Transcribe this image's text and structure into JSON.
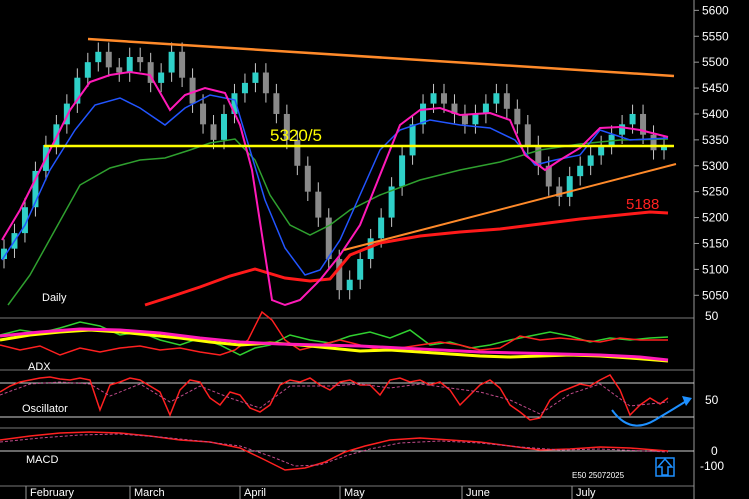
{
  "chart_data": [
    {
      "type": "candlestick",
      "panel_label": "Daily",
      "x_months": [
        "February",
        "March",
        "April",
        "May",
        "June",
        "July"
      ],
      "y_ticks": [
        5050,
        5100,
        5150,
        5200,
        5250,
        5300,
        5350,
        5400,
        5450,
        5500,
        5550,
        5600
      ],
      "ylim": [
        5010,
        5620
      ],
      "annotations": [
        {
          "label": "5320/5",
          "value": 5322,
          "color": "#ffff00"
        },
        {
          "label": "5188",
          "value": 5188,
          "color": "#ff2020"
        }
      ],
      "approx_closes": [
        5140,
        5170,
        5220,
        5290,
        5340,
        5380,
        5420,
        5470,
        5500,
        5520,
        5490,
        5480,
        5510,
        5500,
        5460,
        5480,
        5520,
        5470,
        5420,
        5380,
        5350,
        5400,
        5440,
        5460,
        5480,
        5440,
        5400,
        5350,
        5300,
        5250,
        5200,
        5120,
        5060,
        5080,
        5120,
        5160,
        5200,
        5260,
        5320,
        5380,
        5420,
        5440,
        5420,
        5400,
        5380,
        5400,
        5420,
        5440,
        5410,
        5380,
        5340,
        5300,
        5260,
        5240,
        5280,
        5300,
        5320,
        5340,
        5360,
        5380,
        5400,
        5360,
        5330,
        5340
      ]
    },
    {
      "type": "line",
      "panel_label": "ADX",
      "y_ticks": [
        50
      ]
    },
    {
      "type": "line",
      "panel_label": "Oscillator",
      "y_ticks": [
        50
      ]
    },
    {
      "type": "line",
      "panel_label": "MACD",
      "y_ticks": [
        0,
        -100
      ]
    }
  ],
  "footer": {
    "code": "E50 25072025"
  }
}
